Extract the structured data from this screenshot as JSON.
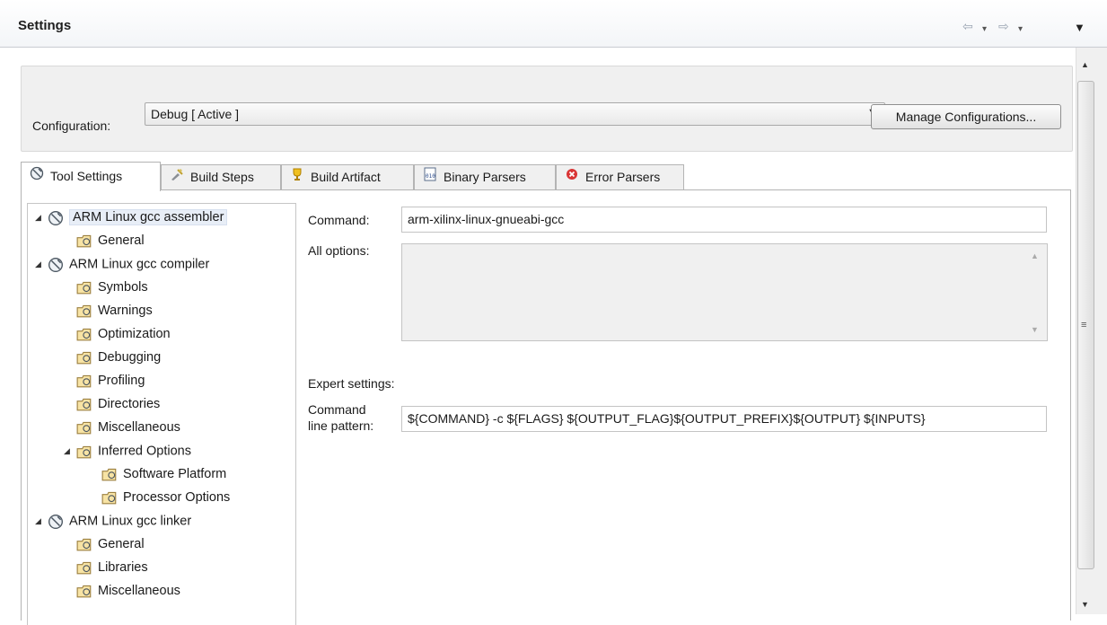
{
  "header": {
    "title": "Settings",
    "nav_back_icon": "⇦",
    "nav_forward_icon": "⇨",
    "dropdown_icon": "▾",
    "menu_icon": "▼"
  },
  "config": {
    "label": "Configuration:",
    "selected": "Debug  [ Active ]",
    "manage_button": "Manage Configurations..."
  },
  "tabs": [
    {
      "label": "Tool Settings",
      "icon": "tool-icon"
    },
    {
      "label": "Build Steps",
      "icon": "build-steps-icon"
    },
    {
      "label": "Build Artifact",
      "icon": "trophy-icon"
    },
    {
      "label": "Binary Parsers",
      "icon": "binary-icon"
    },
    {
      "label": "Error Parsers",
      "icon": "error-icon"
    }
  ],
  "tree": [
    {
      "label": "ARM Linux gcc assembler",
      "expanded": true
    },
    {
      "label": "General"
    },
    {
      "label": "ARM Linux gcc compiler",
      "expanded": true
    },
    {
      "label": "Symbols"
    },
    {
      "label": "Warnings"
    },
    {
      "label": "Optimization"
    },
    {
      "label": "Debugging"
    },
    {
      "label": "Profiling"
    },
    {
      "label": "Directories"
    },
    {
      "label": "Miscellaneous"
    },
    {
      "label": "Inferred Options",
      "expanded": true
    },
    {
      "label": "Software Platform"
    },
    {
      "label": "Processor Options"
    },
    {
      "label": "ARM Linux gcc linker",
      "expanded": true
    },
    {
      "label": "General"
    },
    {
      "label": "Libraries"
    },
    {
      "label": "Miscellaneous"
    }
  ],
  "form": {
    "command_label": "Command:",
    "command_value": "arm-xilinx-linux-gnueabi-gcc",
    "all_options_label": "All options:",
    "expert_label": "Expert settings:",
    "pattern_label_line1": "Command",
    "pattern_label_line2": "line pattern:",
    "pattern_value": "${COMMAND} -c ${FLAGS} ${OUTPUT_FLAG}${OUTPUT_PREFIX}${OUTPUT} ${INPUTS}"
  },
  "colors": {
    "accent_selection": "#e8eef7",
    "panel_bg": "#f0f0f0"
  }
}
